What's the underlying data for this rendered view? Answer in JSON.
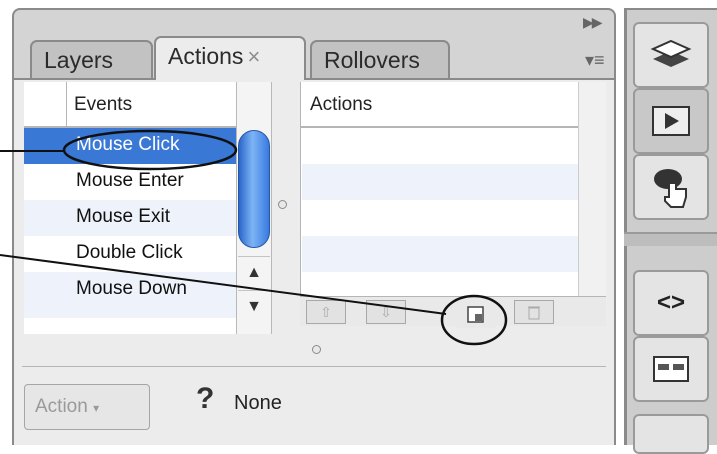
{
  "tabs": [
    {
      "label": "Layers"
    },
    {
      "label": "Actions",
      "close": "×"
    },
    {
      "label": "Rollovers"
    }
  ],
  "events": {
    "header": "Events",
    "items": [
      "Mouse Click",
      "Mouse Enter",
      "Mouse Exit",
      "Double Click",
      "Mouse Down"
    ],
    "selected": "Mouse Click"
  },
  "actions": {
    "header": "Actions"
  },
  "footer": {
    "action_button": "Action",
    "help": "?",
    "status": "None"
  },
  "colors": {
    "selection": "#3a78d6",
    "scroll_thumb": "#4d8fe3"
  },
  "icons": [
    "expand-icon",
    "panel-menu-icon",
    "layers-icon",
    "play-icon",
    "hand-pointer-icon",
    "code-icon",
    "table-icon",
    "arrow-up-icon",
    "arrow-down-icon",
    "new-action-icon",
    "trash-icon",
    "scroll-up-icon",
    "scroll-down-icon",
    "resize-handle-icon"
  ]
}
